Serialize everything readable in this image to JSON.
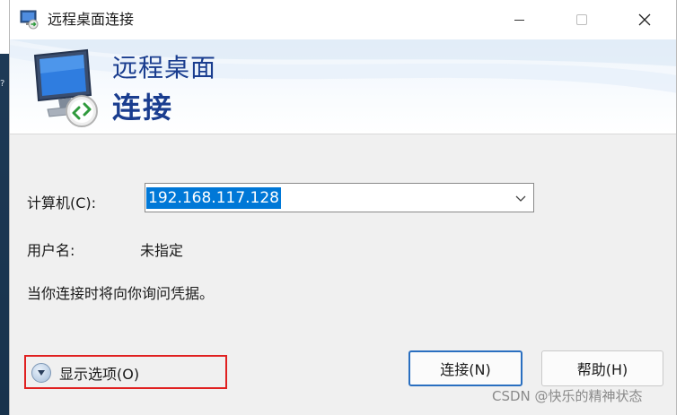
{
  "window": {
    "title": "远程桌面连接"
  },
  "banner": {
    "line1": "远程桌面",
    "line2": "连接"
  },
  "form": {
    "computer_label": "计算机(C):",
    "computer_value": "192.168.117.128",
    "user_label": "用户名:",
    "user_value": "未指定",
    "prompt_text": "当你连接时将向你询问凭据。"
  },
  "footer": {
    "show_options_label": "显示选项(O)",
    "connect_label": "连接(N)",
    "help_label": "帮助(H)"
  },
  "watermark": "CSDN @快乐的精神状态",
  "colors": {
    "accent": "#0078d7",
    "banner_text": "#1a3d8f",
    "highlight_box": "#e02020",
    "default_button_border": "#2a6fc0"
  },
  "icons": [
    "remote-desktop-icon",
    "minimize-icon",
    "maximize-icon",
    "close-icon",
    "monitor-icon",
    "dropdown-arrow-icon",
    "expand-options-icon"
  ]
}
